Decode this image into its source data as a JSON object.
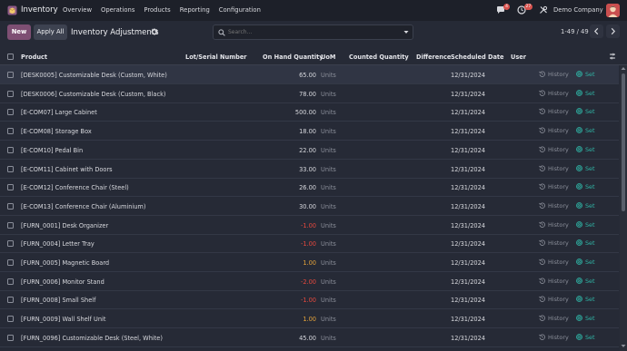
{
  "navbar": {
    "app_name": "Inventory",
    "menu": [
      "Overview",
      "Operations",
      "Products",
      "Reporting",
      "Configuration"
    ],
    "messages_badge": "4",
    "activity_badge": "27",
    "company": "Demo Company"
  },
  "control_panel": {
    "new_label": "New",
    "apply_all_label": "Apply All",
    "title": "Inventory Adjustments",
    "search_placeholder": "Search...",
    "pager": "1-49 / 49"
  },
  "columns": {
    "product": "Product",
    "lot": "Lot/Serial Number",
    "on_hand": "On Hand Quantity",
    "uom": "UoM",
    "counted": "Counted Quantity",
    "difference": "Difference",
    "scheduled": "Scheduled Date",
    "user": "User"
  },
  "row_actions": {
    "history": "History",
    "set": "Set"
  },
  "colors": {
    "accent": "#7e4f73",
    "set": "#2fb5a6",
    "negative": "#e8493e",
    "positive": "#e7a43a",
    "background": "#262a36"
  },
  "rows": [
    {
      "product": "[DESK0005] Customizable Desk (Custom, White)",
      "on_hand": "65.00",
      "uom": "Units",
      "date": "12/31/2024",
      "status": "normal"
    },
    {
      "product": "[DESK0006] Customizable Desk (Custom, Black)",
      "on_hand": "78.00",
      "uom": "Units",
      "date": "12/31/2024",
      "status": "normal"
    },
    {
      "product": "[E-COM07] Large Cabinet",
      "on_hand": "500.00",
      "uom": "Units",
      "date": "12/31/2024",
      "status": "normal"
    },
    {
      "product": "[E-COM08] Storage Box",
      "on_hand": "18.00",
      "uom": "Units",
      "date": "12/31/2024",
      "status": "normal"
    },
    {
      "product": "[E-COM10] Pedal Bin",
      "on_hand": "22.00",
      "uom": "Units",
      "date": "12/31/2024",
      "status": "normal"
    },
    {
      "product": "[E-COM11] Cabinet with Doors",
      "on_hand": "33.00",
      "uom": "Units",
      "date": "12/31/2024",
      "status": "normal"
    },
    {
      "product": "[E-COM12] Conference Chair (Steel)",
      "on_hand": "26.00",
      "uom": "Units",
      "date": "12/31/2024",
      "status": "normal"
    },
    {
      "product": "[E-COM13] Conference Chair (Aluminium)",
      "on_hand": "30.00",
      "uom": "Units",
      "date": "12/31/2024",
      "status": "normal"
    },
    {
      "product": "[FURN_0001] Desk Organizer",
      "on_hand": "-1.00",
      "uom": "Units",
      "date": "12/31/2024",
      "status": "negative"
    },
    {
      "product": "[FURN_0004] Letter Tray",
      "on_hand": "-1.00",
      "uom": "Units",
      "date": "12/31/2024",
      "status": "negative"
    },
    {
      "product": "[FURN_0005] Magnetic Board",
      "on_hand": "1.00",
      "uom": "Units",
      "date": "12/31/2024",
      "status": "positive"
    },
    {
      "product": "[FURN_0006] Monitor Stand",
      "on_hand": "-2.00",
      "uom": "Units",
      "date": "12/31/2024",
      "status": "negative"
    },
    {
      "product": "[FURN_0008] Small Shelf",
      "on_hand": "-1.00",
      "uom": "Units",
      "date": "12/31/2024",
      "status": "negative"
    },
    {
      "product": "[FURN_0009] Wall Shelf Unit",
      "on_hand": "1.00",
      "uom": "Units",
      "date": "12/31/2024",
      "status": "positive"
    },
    {
      "product": "[FURN_0096] Customizable Desk (Steel, White)",
      "on_hand": "45.00",
      "uom": "Units",
      "date": "12/31/2024",
      "status": "normal"
    }
  ]
}
